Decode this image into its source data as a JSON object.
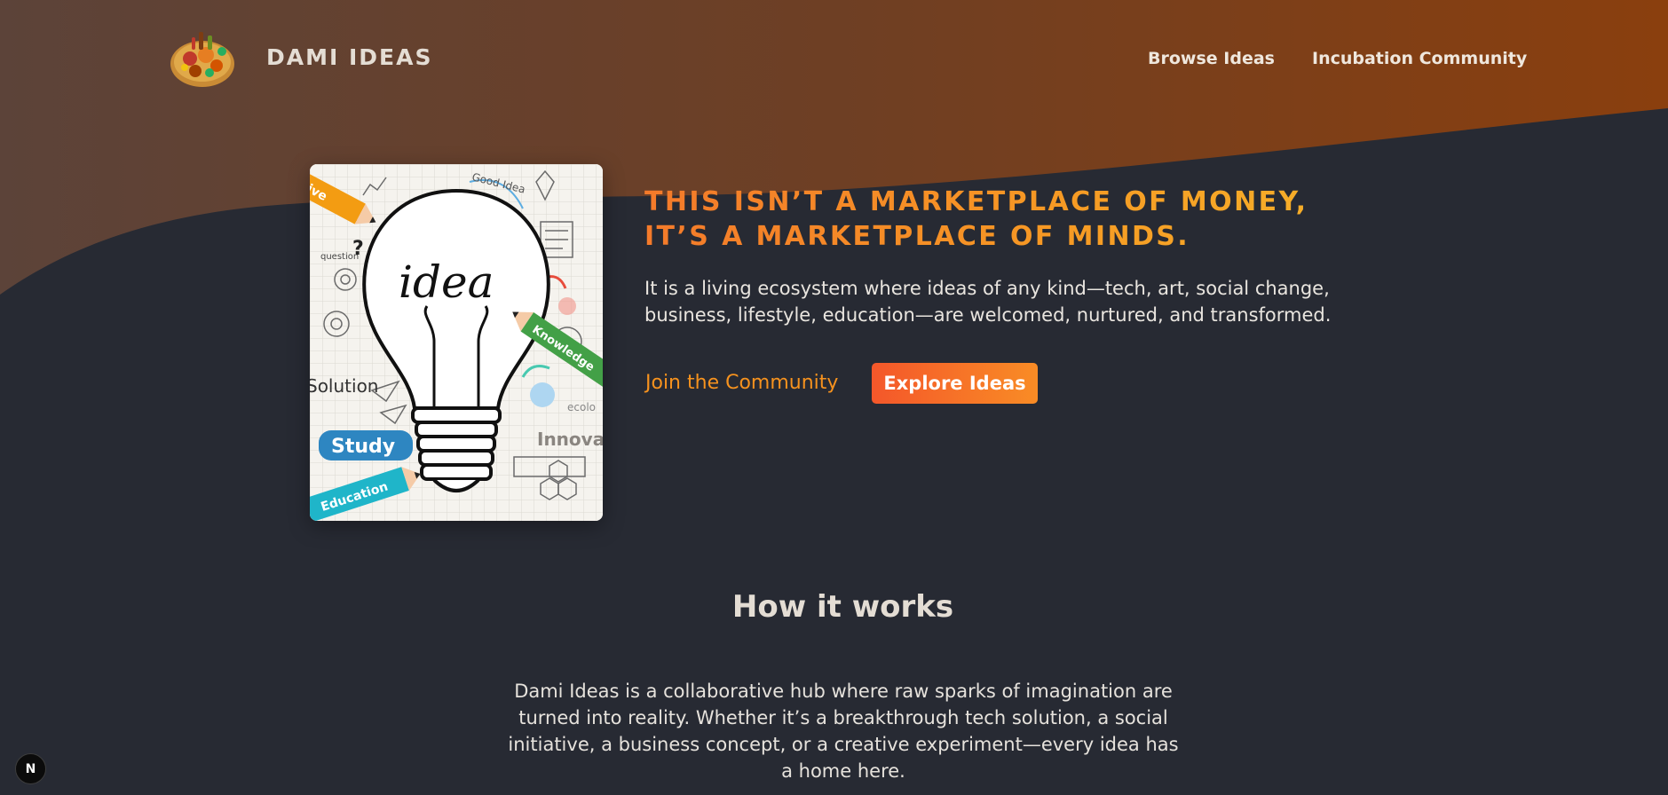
{
  "header": {
    "brand": "DAMI IDEAS",
    "logo_icon": "food-platter-logo-icon",
    "nav": [
      {
        "label": "Browse Ideas"
      },
      {
        "label": "Incubation Community"
      }
    ]
  },
  "hero": {
    "image_icon": "lightbulb-idea-illustration",
    "image_text": {
      "idea": "idea",
      "good_idea": "Good Idea",
      "question": "question",
      "solution": "Solution",
      "study": "Study",
      "education": "Education",
      "knowledge": "Knowledge",
      "innovation": "Innovat",
      "creative": "ative",
      "eco": "ecolo"
    },
    "headline_line1": "THIS ISN’T A MARKETPLACE OF MONEY,",
    "headline_line2": "IT’S A MARKETPLACE OF MINDS.",
    "subtext_line1": "It is a living ecosystem where ideas of any kind—tech, art, social change,",
    "subtext_line2": "business, lifestyle, education—are welcomed, nurtured, and transformed.",
    "join_label": "Join the Community",
    "explore_label": "Explore Ideas"
  },
  "how": {
    "title": "How it works",
    "lines": [
      "Dami Ideas is a collaborative hub where raw sparks of imagination are",
      "turned into reality. Whether it’s a breakthrough tech solution, a social",
      "initiative, a business concept, or a creative experiment—every idea has",
      "a home here."
    ]
  },
  "dev_badge": {
    "label": "N"
  },
  "colors": {
    "background": "#272a33",
    "header_gradient_start": "#5c4339",
    "header_gradient_end": "#8a3f0e",
    "accent_orange": "#f6921e",
    "button_gradient_start": "#f4572a",
    "button_gradient_end": "#f98c25"
  }
}
